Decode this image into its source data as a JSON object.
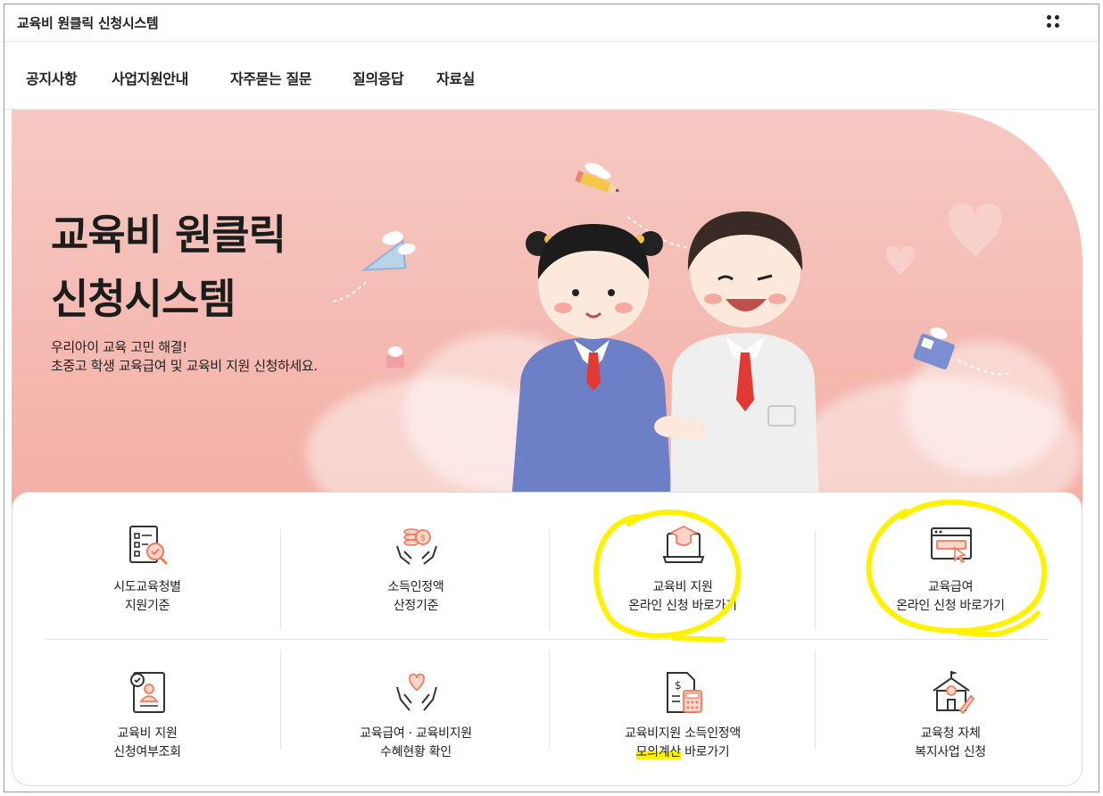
{
  "app": {
    "title": "교육비 원클릭 신청시스템",
    "menu_icon": "apps-dots-icon"
  },
  "nav": {
    "items": [
      "공지사항",
      "사업지원안내",
      "자주묻는 질문",
      "질의응답",
      "자료실"
    ]
  },
  "hero": {
    "title_line1": "교육비 원클릭",
    "title_line2": "신청시스템",
    "subtitle_line1": "우리아이 교육 고민 해결!",
    "subtitle_line2": "초중고 학생 교육급여 및 교육비 지원 신청하세요."
  },
  "services": [
    {
      "line1": "시도교육청별",
      "line2": "지원기준",
      "icon": "document-search-icon"
    },
    {
      "line1": "소득인정액",
      "line2": "산정기준",
      "icon": "hands-coins-icon"
    },
    {
      "line1": "교육비 지원",
      "line2": "온라인 신청 바로가기",
      "icon": "laptop-graduation-icon"
    },
    {
      "line1": "교육급여",
      "line2": "온라인 신청 바로가기",
      "icon": "browser-window-icon"
    },
    {
      "line1": "교육비 지원",
      "line2": "신청여부조회",
      "icon": "profile-check-icon"
    },
    {
      "line1": "교육급여 · 교육비지원",
      "line2": "수혜현황 확인",
      "icon": "hands-heart-icon"
    },
    {
      "line1": "교육비지원 소득인정액",
      "line2_highlight": "모의계산",
      "line2_rest": " 바로가기",
      "icon": "calculator-document-icon"
    },
    {
      "line1": "교육청 자체",
      "line2": "복지사업 신청",
      "icon": "school-pencil-icon"
    }
  ],
  "colors": {
    "accent": "#f07a5c",
    "hero_bg": "#f3aea4",
    "highlight": "#fff200"
  }
}
